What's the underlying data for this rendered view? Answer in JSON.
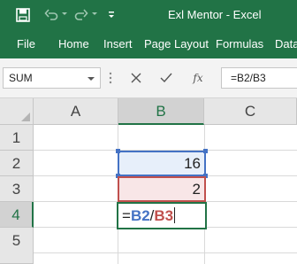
{
  "window": {
    "title": "Exl Mentor  -  Excel"
  },
  "quick_access": {
    "icons": [
      "save-icon",
      "undo-icon",
      "redo-icon",
      "customize-qat-icon"
    ]
  },
  "ribbon": {
    "tabs": [
      "File",
      "Home",
      "Insert",
      "Page Layout",
      "Formulas",
      "Data"
    ]
  },
  "formula_bar": {
    "name_box": "SUM",
    "cancel_icon": "cancel-icon",
    "enter_icon": "enter-icon",
    "fx_label": "fx",
    "formula": "=B2/B3"
  },
  "sheet": {
    "columns": [
      "A",
      "B",
      "C"
    ],
    "rows": [
      "1",
      "2",
      "3",
      "4",
      "5"
    ],
    "cells": {
      "B2": "16",
      "B3": "2",
      "B4": {
        "eq": "=",
        "ref1": "B2",
        "op": "/",
        "ref2": "B3"
      }
    },
    "ref_colors": {
      "ref1": "#4472c4",
      "ref2": "#c0504d"
    },
    "accent": "#217346"
  }
}
